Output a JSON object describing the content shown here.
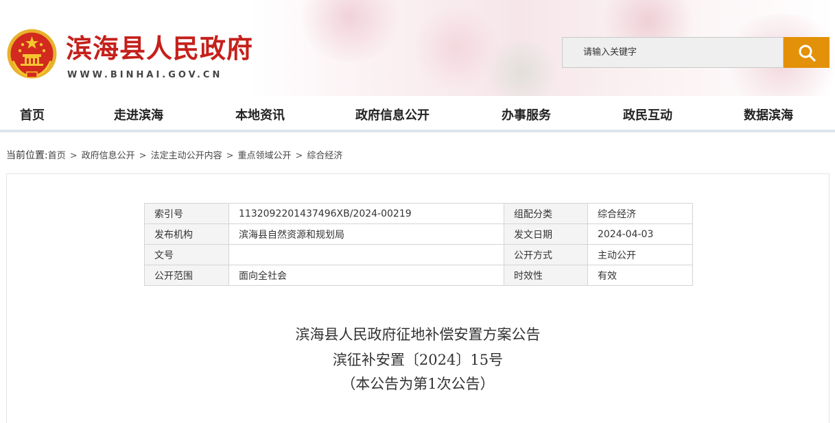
{
  "header": {
    "site_title": "滨海县人民政府",
    "site_url": "WWW.BINHAI.GOV.CN",
    "search_placeholder": "请输入关键字",
    "accent_color": "#c5201b",
    "search_button_color": "#e39109"
  },
  "nav": {
    "items": [
      "首页",
      "走进滨海",
      "本地资讯",
      "政府信息公开",
      "办事服务",
      "政民互动",
      "数据滨海"
    ]
  },
  "breadcrumb": {
    "prefix": "当前位置:",
    "items": [
      "首页",
      "政府信息公开",
      "法定主动公开内容",
      "重点领域公开",
      "综合经济"
    ],
    "separator": ">"
  },
  "meta": {
    "rows": [
      [
        "索引号",
        "1132092201437496XB/2024-00219",
        "组配分类",
        "综合经济"
      ],
      [
        "发布机构",
        "滨海县自然资源和规划局",
        "发文日期",
        "2024-04-03"
      ],
      [
        "文号",
        "",
        "公开方式",
        "主动公开"
      ],
      [
        "公开范围",
        "面向全社会",
        "时效性",
        "有效"
      ]
    ]
  },
  "document": {
    "title": "滨海县人民政府征地补偿安置方案公告",
    "number": "滨征补安置〔2024〕15号",
    "note": "（本公告为第1次公告）"
  }
}
